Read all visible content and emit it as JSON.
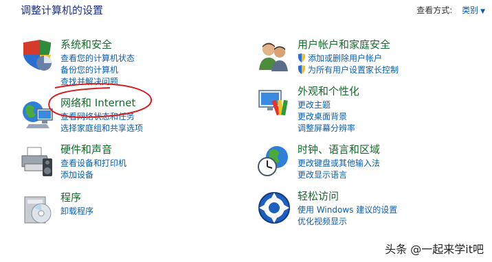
{
  "page": {
    "title": "调整计算机的设置"
  },
  "view_by": {
    "label": "查看方式:",
    "value": "类别"
  },
  "left_categories": [
    {
      "title": "系统和安全",
      "icon": "security-shield-icon",
      "links": [
        "查看您的计算机状态",
        "备份您的计算机",
        "查找并解决问题"
      ]
    },
    {
      "title": "网络和 Internet",
      "icon": "network-globe-icon",
      "links": [
        "查看网络状态和任务",
        "选择家庭组和共享选项"
      ]
    },
    {
      "title": "硬件和声音",
      "icon": "printer-speaker-icon",
      "links": [
        "查看设备和打印机",
        "添加设备"
      ]
    },
    {
      "title": "程序",
      "icon": "programs-disc-icon",
      "links": [
        "卸载程序"
      ]
    }
  ],
  "right_categories": [
    {
      "title": "用户帐户和家庭安全",
      "icon": "users-icon",
      "links": [
        "添加或删除用户帐户",
        "为所有用户设置家长控制"
      ]
    },
    {
      "title": "外观和个性化",
      "icon": "monitor-palette-icon",
      "links": [
        "更改主题",
        "更改桌面背景",
        "调整屏幕分辨率"
      ]
    },
    {
      "title": "时钟、语言和区域",
      "icon": "globe-clock-icon",
      "links": [
        "更改键盘或其他输入法",
        "更改显示语言"
      ]
    },
    {
      "title": "轻松访问",
      "icon": "ease-of-access-icon",
      "links": [
        "使用 Windows 建议的设置",
        "优化视频显示"
      ]
    }
  ],
  "colors": {
    "category_title": "#156b2a",
    "link": "#0a5fb4",
    "page_title": "#1e3287",
    "annotation": "#d42020"
  },
  "watermark": "头条 @一起来学it吧"
}
